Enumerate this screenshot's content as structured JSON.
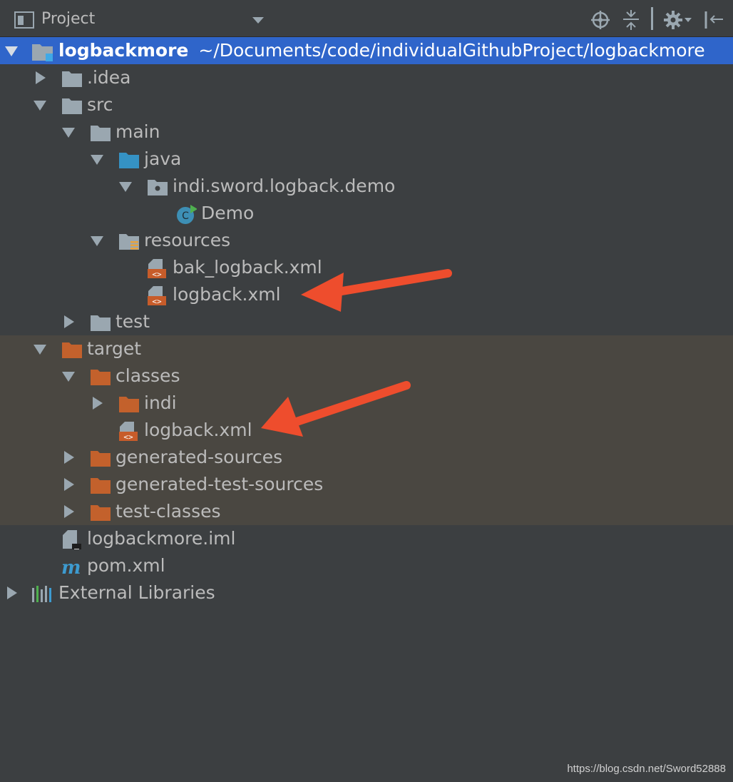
{
  "toolbar": {
    "title": "Project",
    "icons": [
      "project-view-icon",
      "dropdown-arrow-icon",
      "locate-icon",
      "collapse-all-icon",
      "gear-icon",
      "hide-panel-icon"
    ]
  },
  "tree": {
    "root_name": "logbackmore",
    "root_path": "~/Documents/code/individualGithubProject/logbackmore",
    "items": {
      "idea": ".idea",
      "src": "src",
      "main": "main",
      "java": "java",
      "package": "indi.sword.logback.demo",
      "demo": "Demo",
      "resources": "resources",
      "bak_logback": "bak_logback.xml",
      "logback_src": "logback.xml",
      "test": "test",
      "target": "target",
      "classes": "classes",
      "indi": "indi",
      "logback_target": "logback.xml",
      "generated_sources": "generated-sources",
      "generated_test_sources": "generated-test-sources",
      "test_classes": "test-classes",
      "iml": "logbackmore.iml",
      "pom": "pom.xml",
      "external": "External Libraries"
    }
  },
  "annotations": {
    "arrow_color": "#ee4d2d"
  },
  "watermark": "https://blog.csdn.net/Sword52888"
}
